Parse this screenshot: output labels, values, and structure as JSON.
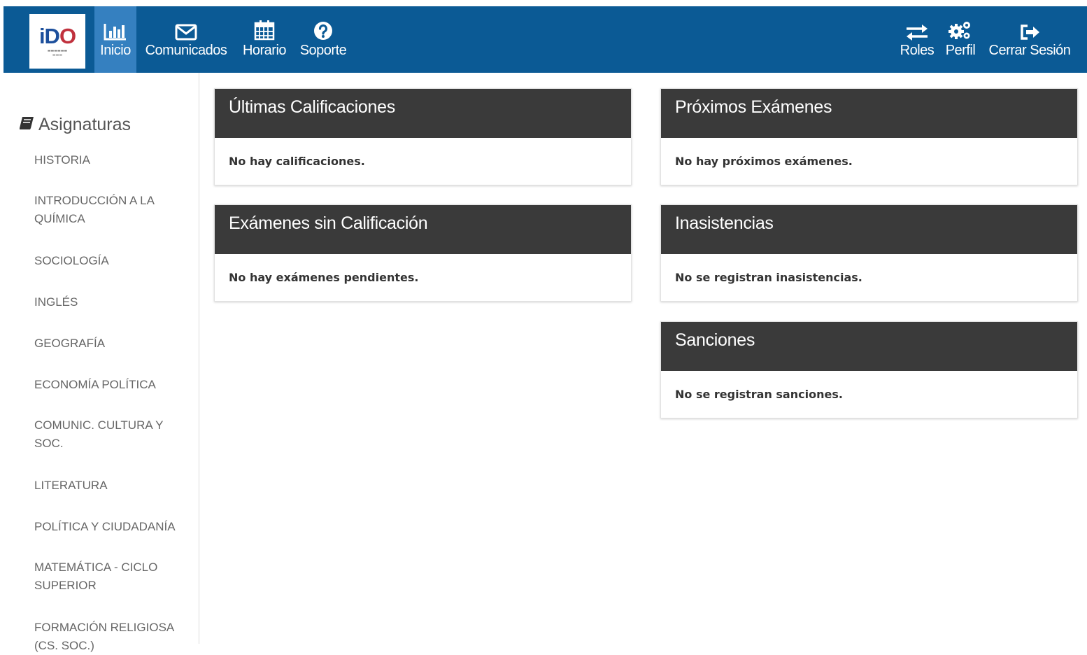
{
  "navbar": {
    "logo": {
      "text": "iDO"
    },
    "left_items": [
      {
        "label": "Inicio",
        "icon": "bar-chart-icon"
      },
      {
        "label": "Comunicados",
        "icon": "envelope-icon"
      },
      {
        "label": "Horario",
        "icon": "calendar-icon"
      },
      {
        "label": "Soporte",
        "icon": "question-circle-icon"
      }
    ],
    "right_items": [
      {
        "label": "Roles",
        "icon": "exchange-icon"
      },
      {
        "label": "Perfil",
        "icon": "cogs-icon"
      },
      {
        "label": "Cerrar Sesión",
        "icon": "sign-out-icon"
      }
    ],
    "colors": {
      "bar": "#0b5a95",
      "active": "#3580c0"
    }
  },
  "sidebar": {
    "title": "Asignaturas",
    "items": [
      "HISTORIA",
      "INTRODUCCIÓN A LA QUÍMICA",
      "SOCIOLOGÍA",
      "INGLÉS",
      "GEOGRAFÍA",
      "ECONOMÍA POLÍTICA",
      "COMUNIC. CULTURA Y SOC.",
      "LITERATURA",
      "POLÍTICA Y CIUDADANÍA",
      "MATEMÁTICA - CICLO SUPERIOR",
      "FORMACIÓN RELIGIOSA (CS. SOC.)"
    ]
  },
  "panels": {
    "ultimas_calificaciones": {
      "title": "Últimas Calificaciones",
      "message": "No hay calificaciones."
    },
    "proximos_examenes": {
      "title": "Próximos Exámenes",
      "message": "No hay próximos exámenes."
    },
    "examenes_sin_calificacion": {
      "title": "Exámenes sin Calificación",
      "message": "No hay exámenes pendientes."
    },
    "inasistencias": {
      "title": "Inasistencias",
      "message": "No se registran inasistencias."
    },
    "sanciones": {
      "title": "Sanciones",
      "message": "No se registran sanciones."
    },
    "header_color": "#3a3a3a"
  }
}
